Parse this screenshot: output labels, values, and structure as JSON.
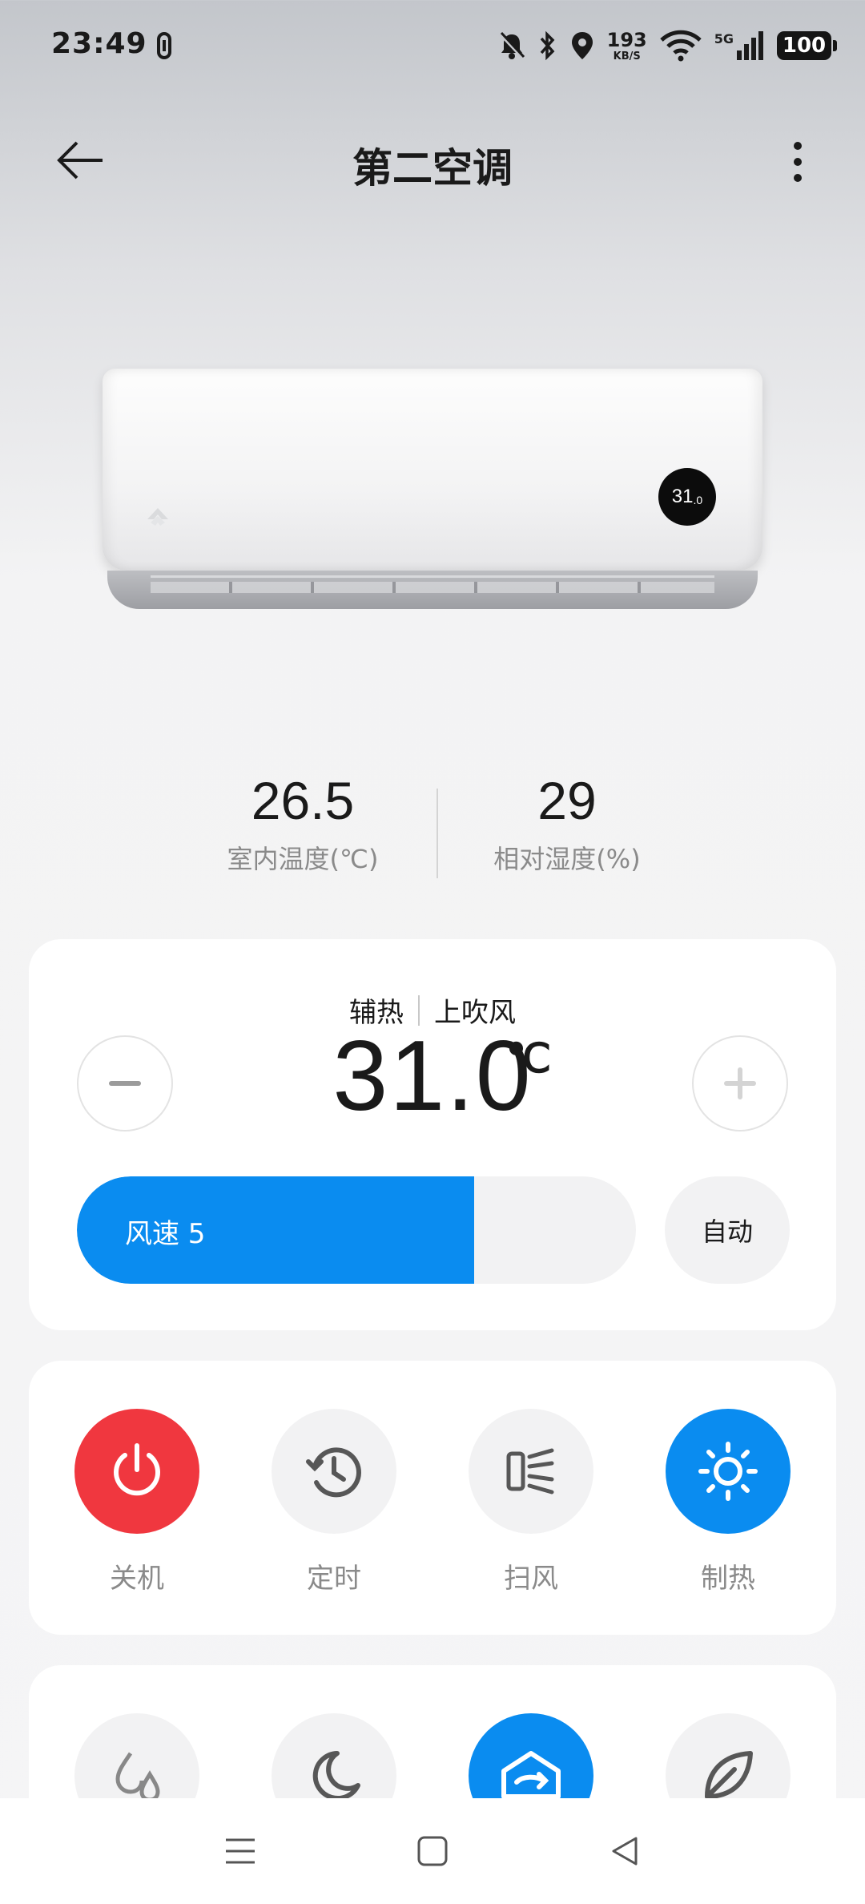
{
  "status_bar": {
    "time": "23:49",
    "net_speed_value": "193",
    "net_speed_unit": "KB/S",
    "network": "5G",
    "battery": "100",
    "icons": [
      "mute-bell-icon",
      "bluetooth-icon",
      "location-icon",
      "wifi-icon",
      "signal-icon"
    ]
  },
  "app_bar": {
    "title": "第二空调",
    "back_icon": "arrow-left-icon",
    "more_icon": "more-vertical-icon"
  },
  "ac_unit": {
    "display_value": "31",
    "display_decimal": ".0"
  },
  "readings": {
    "indoor_temp": {
      "value": "26.5",
      "label": "室内温度(℃)"
    },
    "humidity": {
      "value": "29",
      "label": "相对湿度(%)"
    }
  },
  "control": {
    "mode_tags": [
      "辅热",
      "上吹风"
    ],
    "set_temp": "31.0",
    "unit": "℃",
    "minus_icon": "minus-icon",
    "plus_icon": "plus-icon",
    "fan_label": "风速 5",
    "fan_fill_percent": 71,
    "auto_label": "自动",
    "accent_color": "#0a8cf0"
  },
  "modes": [
    {
      "label": "关机",
      "icon": "power-icon",
      "state": "red"
    },
    {
      "label": "定时",
      "icon": "timer-icon",
      "state": "off"
    },
    {
      "label": "扫风",
      "icon": "swing-icon",
      "state": "off"
    },
    {
      "label": "制热",
      "icon": "sun-icon",
      "state": "blue"
    }
  ],
  "extras": [
    {
      "icon": "dehumidify-icon",
      "state": "off"
    },
    {
      "icon": "moon-icon",
      "state": "off"
    },
    {
      "icon": "swing-up-icon",
      "state": "blue"
    },
    {
      "icon": "leaf-icon",
      "state": "off"
    }
  ],
  "nav": [
    "menu-icon",
    "home-square-icon",
    "back-triangle-icon"
  ]
}
